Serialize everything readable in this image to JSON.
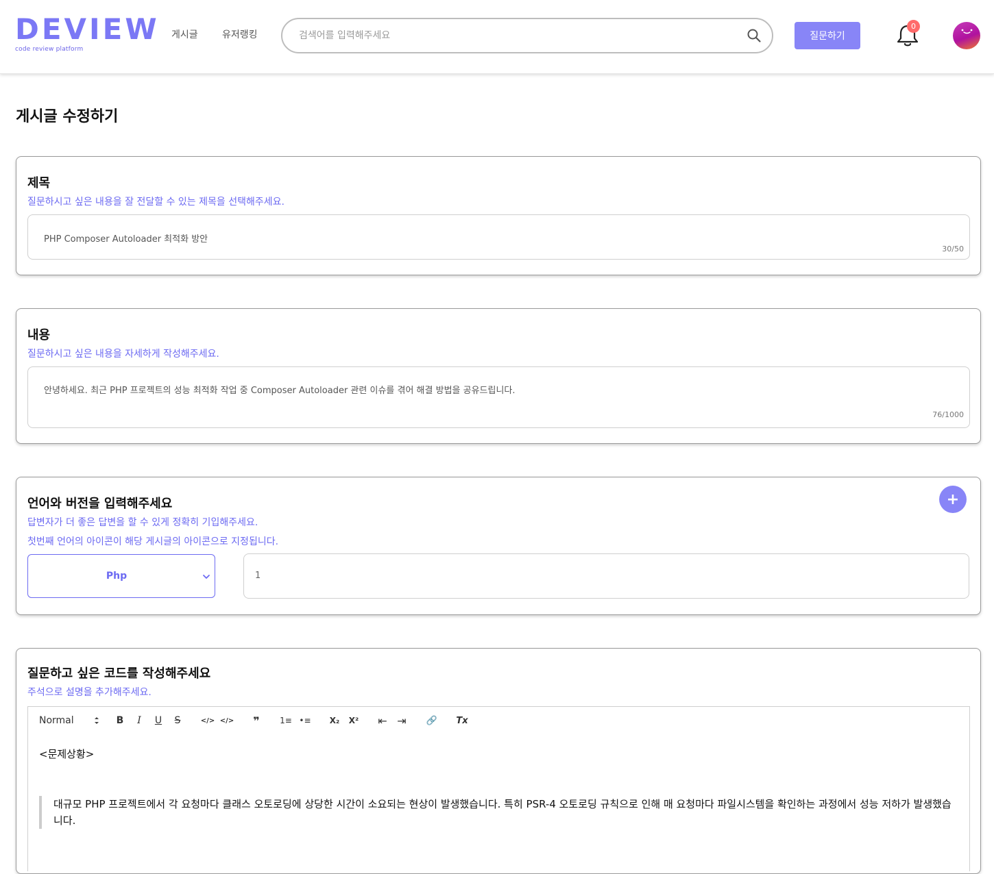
{
  "header": {
    "logo_text": "DEVIEW",
    "logo_tagline": "code review platform",
    "nav": [
      "게시글",
      "유저랭킹"
    ],
    "search_placeholder": "검색어를 입력해주세요",
    "ask_button": "질문하기",
    "notification_count": "0"
  },
  "page": {
    "title": "게시글 수정하기"
  },
  "title_section": {
    "heading": "제목",
    "hint": "질문하시고 싶은 내용을 잘 전달할 수 있는 제목을 선택해주세요.",
    "value": "PHP Composer Autoloader 최적화 방안",
    "counter": "30/50"
  },
  "content_section": {
    "heading": "내용",
    "hint": "질문하시고 싶은 내용을 자세하게 작성해주세요.",
    "value": "안녕하세요. 최근 PHP 프로젝트의 성능 최적화 작업 중 Composer Autoloader 관련 이슈를 겪어 해결 방법을 공유드립니다.",
    "counter": "76/1000"
  },
  "language_section": {
    "heading": "언어와 버전을 입력해주세요",
    "hint1": "답변자가 더 좋은 답변을 할 수 있게 정확히 기입해주세요.",
    "hint2": "첫번째 언어의 아이콘이 해당 게시글의 아이콘으로 지정됩니다.",
    "add_button": "+",
    "language": "Php",
    "version": "1"
  },
  "code_section": {
    "heading": "질문하고 싶은 코드를 작성해주세요",
    "hint": "주석으로 설명을 추가해주세요.",
    "format_select": "Normal",
    "toolbar": {
      "bold": "B",
      "italic": "I",
      "underline": "U",
      "strike": "S",
      "code": "</>",
      "code_block": "</>",
      "quote": "❞",
      "ordered_list": "1≡",
      "bullet_list": "•≡",
      "subscript": "X₂",
      "superscript": "X²",
      "outdent": "⇤",
      "indent": "⇥",
      "link": "🔗",
      "clean": "Tx"
    },
    "line1": "<문제상황>",
    "quote": "대규모 PHP 프로젝트에서 각 요청마다 클래스 오토로딩에 상당한 시간이 소요되는 현상이 발생했습니다. 특히 PSR-4 오토로딩 규칙으로 인해 매 요청마다 파일시스템을 확인하는 과정에서 성능 저하가 발생했습니다."
  },
  "colors": {
    "accent": "#8885f7",
    "accent_text": "#6c6af2",
    "badge": "#ff6b6b"
  }
}
